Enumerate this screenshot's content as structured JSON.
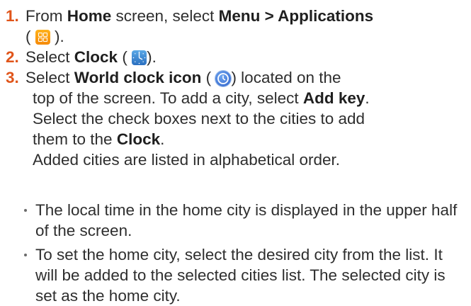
{
  "steps": [
    {
      "number": "1.",
      "line1_pre": "From ",
      "line1_bold1": "Home",
      "line1_mid": " screen, select ",
      "line1_bold2": "Menu > Applications",
      "line2_pre": "(",
      "line2_post": ").",
      "icon": "applications-grid-icon"
    },
    {
      "number": "2.",
      "pre": "Select ",
      "bold": "Clock",
      "paren_open": " (",
      "paren_close": ").",
      "icon": "clock-app-icon"
    },
    {
      "number": "3.",
      "l1_pre": "Select ",
      "l1_bold": "World clock icon",
      "l1_paren_open": " (",
      "l1_post": ") located on the",
      "l2_pre": "top of the screen. To add a city, select ",
      "l2_bold": "Add key",
      "l2_post": ".",
      "l3": "Select the check boxes next to the cities to add",
      "l4_pre": "them to the ",
      "l4_bold": "Clock",
      "l4_post": ".",
      "l5": "Added cities are listed in alphabetical order.",
      "icon": "world-clock-icon"
    }
  ],
  "bullets": [
    "The local time in the home city is displayed in the upper half of the screen.",
    "To set the home city, select the desired city from the list. It will be added to the selected cities list. The selected city is set as the home city."
  ],
  "colors": {
    "step_number": "#e0551a",
    "text": "#2e2e2e"
  }
}
